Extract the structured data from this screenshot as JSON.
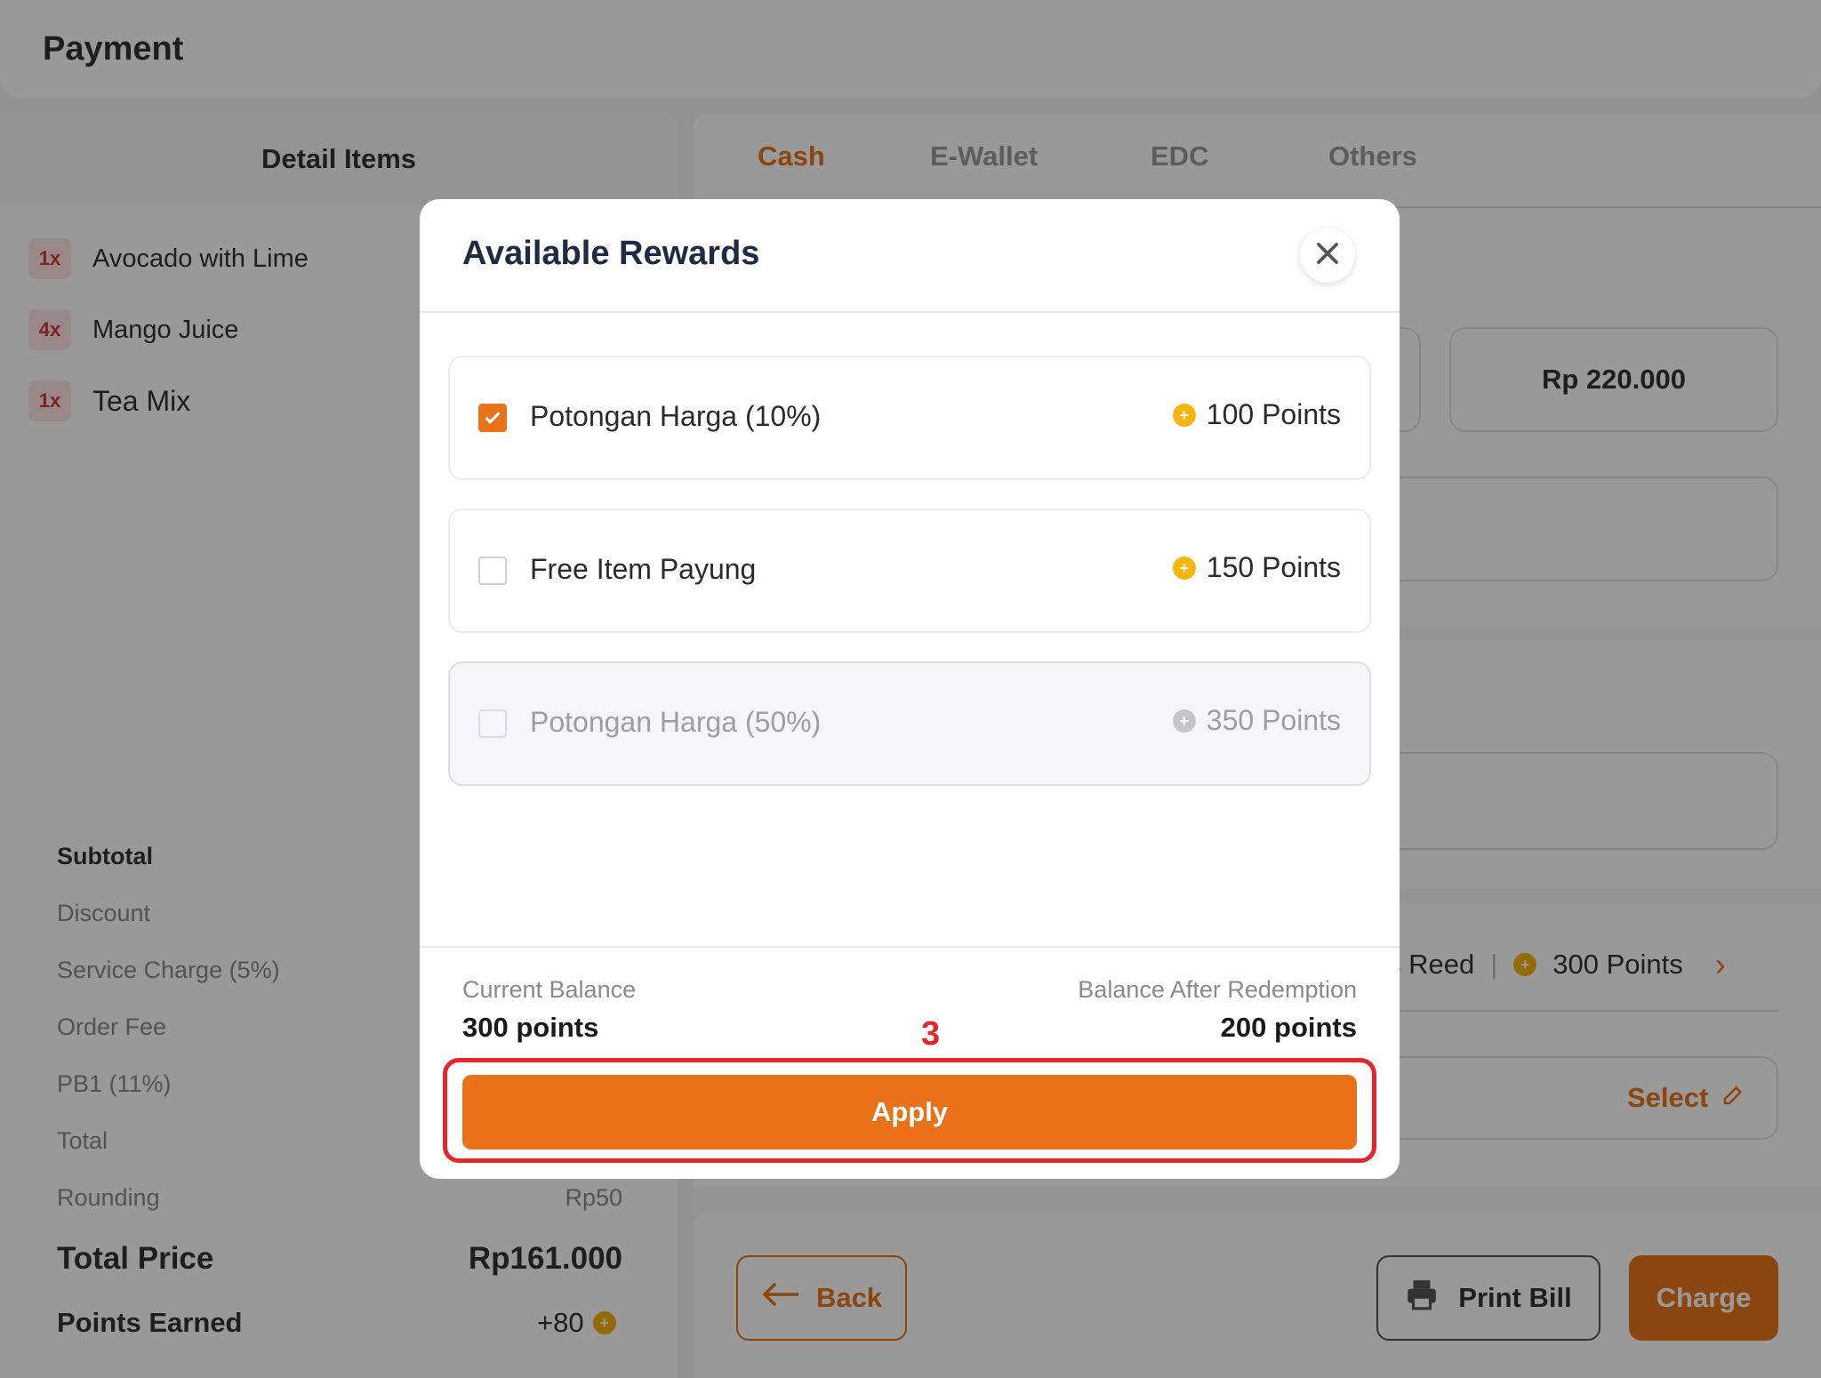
{
  "header": {
    "title": "Payment"
  },
  "detail": {
    "title": "Detail Items",
    "items": [
      {
        "qty": "1x",
        "name": "Avocado with Lime"
      },
      {
        "qty": "4x",
        "name": "Mango Juice"
      },
      {
        "qty": "1x",
        "name": "Tea Mix"
      }
    ]
  },
  "totals": {
    "subtotal_label": "Subtotal",
    "discount_label": "Discount",
    "service_label": "Service Charge (5%)",
    "order_fee_label": "Order Fee",
    "pb1_label": "PB1 (11%)",
    "total_label": "Total",
    "rounding_label": "Rounding",
    "rounding_value": "Rp50",
    "total_price_label": "Total Price",
    "total_price_value": "Rp161.000",
    "points_earned_label": "Points Earned",
    "points_earned_value": "+80"
  },
  "tabs": [
    {
      "label": "Cash",
      "active": true
    },
    {
      "label": "E-Wallet"
    },
    {
      "label": "EDC"
    },
    {
      "label": "Others"
    }
  ],
  "cash": {
    "amount": "Rp 220.000"
  },
  "member": {
    "name_partial": "s Reed",
    "points": "300 Points",
    "select_label": "Select"
  },
  "actions": {
    "back": "Back",
    "print": "Print Bill",
    "charge": "Charge"
  },
  "modal": {
    "title": "Available Rewards",
    "rewards": [
      {
        "name": "Potongan Harga (10%)",
        "points": "100 Points",
        "checked": true,
        "disabled": false
      },
      {
        "name": "Free Item Payung",
        "points": "150 Points",
        "checked": false,
        "disabled": false
      },
      {
        "name": "Potongan Harga (50%)",
        "points": "350 Points",
        "checked": false,
        "disabled": true
      }
    ],
    "current_balance_label": "Current Balance",
    "current_balance_value": "300 points",
    "after_label": "Balance After Redemption",
    "after_value": "200 points",
    "apply_label": "Apply"
  },
  "annotation": {
    "step": "3"
  },
  "colors": {
    "accent": "#e8731a",
    "highlight": "#e4262f",
    "coin": "#f5b50c"
  }
}
